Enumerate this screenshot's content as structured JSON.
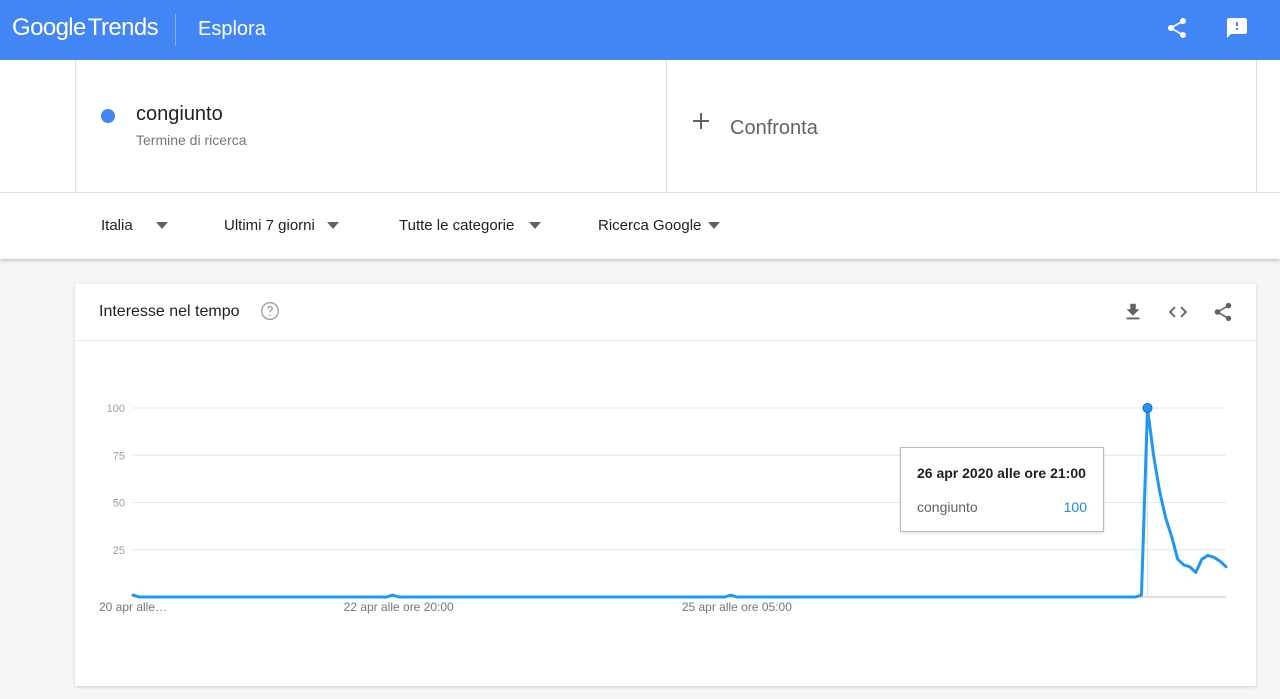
{
  "app": {
    "logo_google": "Google",
    "logo_trends": "Trends",
    "page_title": "Esplora",
    "share_icon": "share-icon",
    "feedback_icon": "feedback-icon",
    "brand_color": "#4285f4"
  },
  "search_term": {
    "name": "congiunto",
    "type": "Termine di ricerca",
    "color": "#4285f4"
  },
  "compare": {
    "label": "Confronta",
    "icon": "plus-icon"
  },
  "filters": [
    {
      "label": "Italia"
    },
    {
      "label": "Ultimi 7 giorni"
    },
    {
      "label": "Tutte le categorie"
    },
    {
      "label": "Ricerca Google"
    }
  ],
  "interest_card": {
    "title": "Interesse nel tempo",
    "help_icon": "help-icon",
    "tools": [
      "download-icon",
      "embed-icon",
      "share-icon"
    ]
  },
  "tooltip": {
    "title": "26 apr 2020 alle ore 21:00",
    "series": "congiunto",
    "value": "100"
  },
  "chart_data": {
    "type": "line",
    "ylim": [
      0,
      100
    ],
    "yticks": [
      100,
      75,
      50,
      25
    ],
    "xtick_labels": [
      "20 apr alle…",
      "22 apr alle ore 20:00",
      "25 apr alle ore 05:00"
    ],
    "xtick_index": [
      0,
      44,
      100
    ],
    "grid": true,
    "series": [
      {
        "color": "#2196f3",
        "values": [
          1,
          0,
          0,
          0,
          0,
          0,
          0,
          0,
          0,
          0,
          0,
          0,
          0,
          0,
          0,
          0,
          0,
          0,
          0,
          0,
          0,
          0,
          0,
          0,
          0,
          0,
          0,
          0,
          0,
          0,
          0,
          0,
          0,
          0,
          0,
          0,
          0,
          0,
          0,
          0,
          0,
          0,
          0,
          1,
          0,
          0,
          0,
          0,
          0,
          0,
          0,
          0,
          0,
          0,
          0,
          0,
          0,
          0,
          0,
          0,
          0,
          0,
          0,
          0,
          0,
          0,
          0,
          0,
          0,
          0,
          0,
          0,
          0,
          0,
          0,
          0,
          0,
          0,
          0,
          0,
          0,
          0,
          0,
          0,
          0,
          0,
          0,
          0,
          0,
          0,
          0,
          0,
          0,
          0,
          0,
          0,
          0,
          0,
          0,
          1,
          0,
          0,
          0,
          0,
          0,
          0,
          0,
          0,
          0,
          0,
          0,
          0,
          0,
          0,
          0,
          0,
          0,
          0,
          0,
          0,
          0,
          0,
          0,
          0,
          0,
          0,
          0,
          0,
          0,
          0,
          0,
          0,
          0,
          0,
          0,
          0,
          0,
          0,
          0,
          0,
          0,
          0,
          0,
          0,
          0,
          0,
          0,
          0,
          0,
          0,
          0,
          0,
          0,
          0,
          0,
          0,
          0,
          0,
          0,
          0,
          0,
          0,
          0,
          0,
          0,
          0,
          0,
          1,
          100,
          75,
          56,
          42,
          32,
          20,
          17,
          16,
          13,
          20,
          22,
          21,
          19,
          16
        ]
      }
    ],
    "highlight_index": 168
  }
}
